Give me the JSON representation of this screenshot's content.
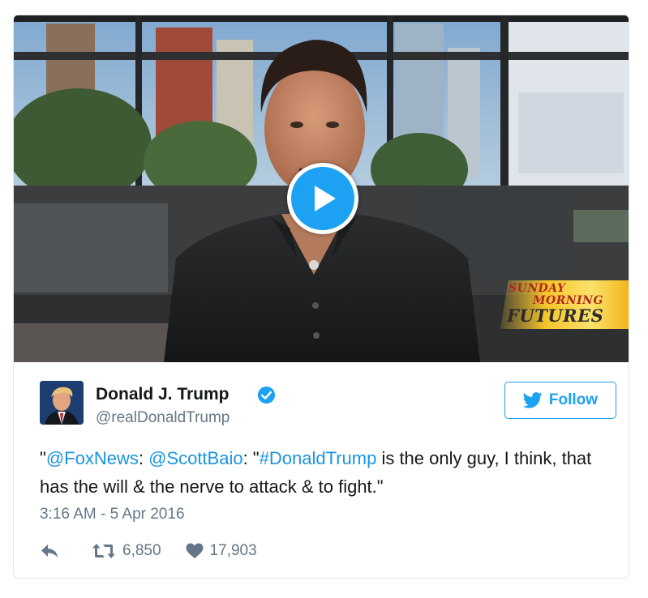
{
  "media": {
    "play_icon": "play-icon",
    "broadcast_logo": {
      "line1": "SUNDAY",
      "line2": "MORNING",
      "line3": "FUTURES"
    }
  },
  "tweet": {
    "author": {
      "name": "Donald J. Trump",
      "handle": "@realDonaldTrump",
      "verified_icon": "verified-badge-icon"
    },
    "follow_button": {
      "label": "Follow",
      "icon": "twitter-bird-icon"
    },
    "text": {
      "q1": "\"",
      "mention1": "@FoxNews",
      "sep1": ": ",
      "mention2": "@ScottBaio",
      "sep2": ": \"",
      "hashtag": "#DonaldTrump",
      "rest": " is the only guy, I think, that has the will & the nerve to attack & to fight.\""
    },
    "timestamp": "3:16 AM - 5 Apr 2016",
    "actions": {
      "reply_icon": "reply-icon",
      "retweet_icon": "retweet-icon",
      "retweets": "6,850",
      "like_icon": "heart-icon",
      "likes": "17,903"
    }
  },
  "colors": {
    "accent": "#1da1f2",
    "link": "#1b95e0",
    "secondary_text": "#657786",
    "border": "#e1e8ed"
  }
}
